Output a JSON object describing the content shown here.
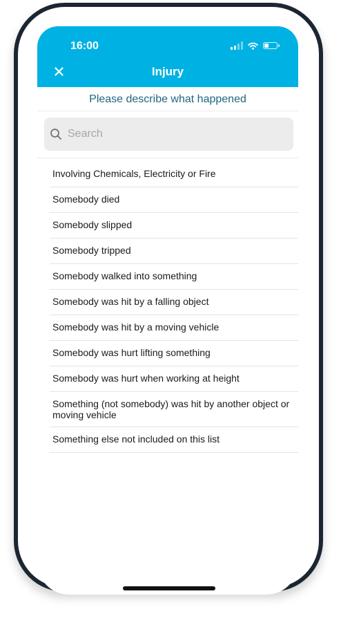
{
  "status_bar": {
    "time": "16:00"
  },
  "header": {
    "title": "Injury",
    "close_icon": "close-icon"
  },
  "prompt": "Please describe what happened",
  "search": {
    "placeholder": "Search",
    "value": ""
  },
  "items": [
    "Involving Chemicals, Electricity or Fire",
    "Somebody died",
    "Somebody slipped",
    "Somebody tripped",
    "Somebody walked into something",
    "Somebody was hit by a falling object",
    "Somebody was hit by a moving vehicle",
    "Somebody was hurt lifting something",
    "Somebody was hurt when working at height",
    "Something (not somebody) was hit by another object or moving vehicle",
    "Something else not included on this list"
  ],
  "colors": {
    "header": "#00b2e3",
    "prompt_text": "#1f6680",
    "frame": "#1c2633"
  },
  "battery_level": 0.35
}
